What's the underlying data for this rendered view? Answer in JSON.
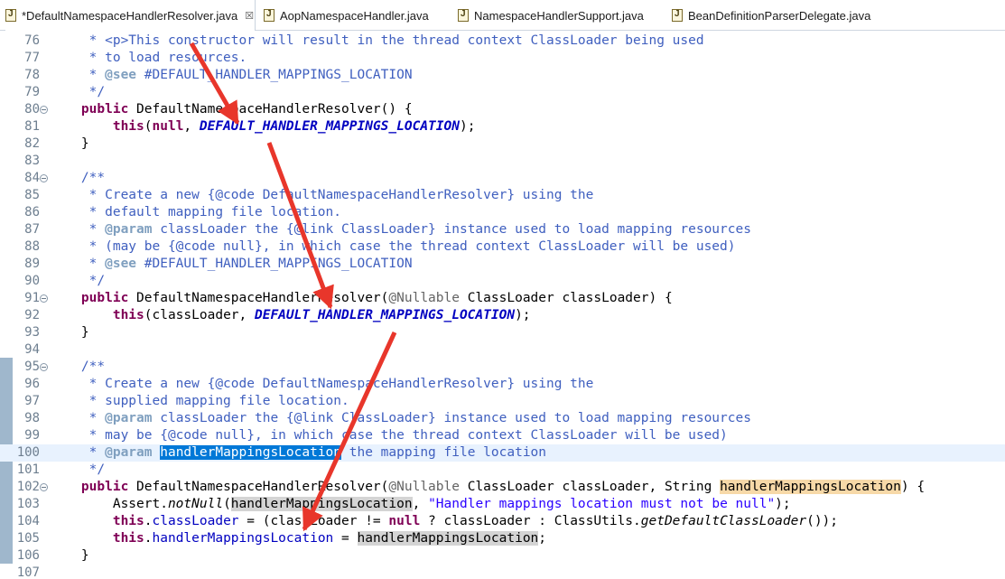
{
  "tabs": [
    {
      "label": "*DefaultNamespaceHandlerResolver.java",
      "close": "☒",
      "icon": "java-file-icon"
    },
    {
      "label": "AopNamespaceHandler.java",
      "icon": "java-file-icon"
    },
    {
      "label": "NamespaceHandlerSupport.java",
      "icon": "java-file-icon"
    },
    {
      "label": "BeanDefinitionParserDelegate.java",
      "icon": "java-file-icon"
    }
  ],
  "colors": {
    "keyword": "#7f0055",
    "comment": "#3f5fbf",
    "javadoc_tag": "#7f9fbf",
    "static_field": "#0000c0",
    "string": "#2a00ff",
    "selection": "#0078d7",
    "annotation_arrow": "#e8362b"
  },
  "editor": {
    "lines": [
      {
        "n": "76",
        "fold": false,
        "t": [
          [
            "cm",
            "     * <p>This constructor will result in the thread context ClassLoader being used"
          ]
        ]
      },
      {
        "n": "77",
        "fold": false,
        "t": [
          [
            "cm",
            "     * to load resources."
          ]
        ]
      },
      {
        "n": "78",
        "fold": false,
        "t": [
          [
            "cm",
            "     * "
          ],
          [
            "tag",
            "@see"
          ],
          [
            "cm",
            " #DEFAULT_HANDLER_MAPPINGS_LOCATION"
          ]
        ]
      },
      {
        "n": "79",
        "fold": false,
        "t": [
          [
            "cm",
            "     */"
          ]
        ]
      },
      {
        "n": "80",
        "fold": true,
        "t": [
          [
            "",
            "    "
          ],
          [
            "k",
            "public"
          ],
          [
            "",
            " DefaultNamespaceHandlerResolver() {"
          ]
        ]
      },
      {
        "n": "81",
        "fold": false,
        "t": [
          [
            "",
            "        "
          ],
          [
            "k",
            "this"
          ],
          [
            "",
            "("
          ],
          [
            "k",
            "null"
          ],
          [
            "",
            ", "
          ],
          [
            "st",
            "DEFAULT_HANDLER_MAPPINGS_LOCATION"
          ],
          [
            "",
            ");"
          ]
        ]
      },
      {
        "n": "82",
        "fold": false,
        "t": [
          [
            "",
            "    }"
          ]
        ]
      },
      {
        "n": "83",
        "fold": false,
        "t": []
      },
      {
        "n": "84",
        "fold": true,
        "t": [
          [
            "cm",
            "    /**"
          ]
        ]
      },
      {
        "n": "85",
        "fold": false,
        "t": [
          [
            "cm",
            "     * Create a new {@code DefaultNamespaceHandlerResolver} using the"
          ]
        ]
      },
      {
        "n": "86",
        "fold": false,
        "t": [
          [
            "cm",
            "     * default mapping file location."
          ]
        ]
      },
      {
        "n": "87",
        "fold": false,
        "t": [
          [
            "cm",
            "     * "
          ],
          [
            "tag",
            "@param"
          ],
          [
            "cm",
            " classLoader the {@link ClassLoader} instance used to load mapping resources"
          ]
        ]
      },
      {
        "n": "88",
        "fold": false,
        "t": [
          [
            "cm",
            "     * (may be {@code null}, in which case the thread context ClassLoader will be used)"
          ]
        ]
      },
      {
        "n": "89",
        "fold": false,
        "t": [
          [
            "cm",
            "     * "
          ],
          [
            "tag",
            "@see"
          ],
          [
            "cm",
            " #DEFAULT_HANDLER_MAPPINGS_LOCATION"
          ]
        ]
      },
      {
        "n": "90",
        "fold": false,
        "t": [
          [
            "cm",
            "     */"
          ]
        ]
      },
      {
        "n": "91",
        "fold": true,
        "t": [
          [
            "",
            "    "
          ],
          [
            "k",
            "public"
          ],
          [
            "",
            " DefaultNamespaceHandlerResolver("
          ],
          [
            "an",
            "@Nullable"
          ],
          [
            "",
            " ClassLoader classLoader) {"
          ]
        ]
      },
      {
        "n": "92",
        "fold": false,
        "t": [
          [
            "",
            "        "
          ],
          [
            "k",
            "this"
          ],
          [
            "",
            "(classLoader, "
          ],
          [
            "st",
            "DEFAULT_HANDLER_MAPPINGS_LOCATION"
          ],
          [
            "",
            ");"
          ]
        ]
      },
      {
        "n": "93",
        "fold": false,
        "t": [
          [
            "",
            "    }"
          ]
        ]
      },
      {
        "n": "94",
        "fold": false,
        "t": []
      },
      {
        "n": "95",
        "fold": true,
        "t": [
          [
            "cm",
            "    /**"
          ]
        ]
      },
      {
        "n": "96",
        "fold": false,
        "t": [
          [
            "cm",
            "     * Create a new {@code DefaultNamespaceHandlerResolver} using the"
          ]
        ]
      },
      {
        "n": "97",
        "fold": false,
        "t": [
          [
            "cm",
            "     * supplied mapping file location."
          ]
        ]
      },
      {
        "n": "98",
        "fold": false,
        "t": [
          [
            "cm",
            "     * "
          ],
          [
            "tag",
            "@param"
          ],
          [
            "cm",
            " classLoader the {@link ClassLoader} instance used to load mapping resources"
          ]
        ]
      },
      {
        "n": "99",
        "fold": false,
        "t": [
          [
            "cm",
            "     * may be {@code null}, in which case the thread context ClassLoader will be used)"
          ]
        ]
      },
      {
        "n": "100",
        "fold": false,
        "current": true,
        "t": [
          [
            "cm",
            "     * "
          ],
          [
            "tag",
            "@param"
          ],
          [
            "cm",
            " "
          ],
          [
            "sel",
            "handlerMappingsLocation"
          ],
          [
            "cm",
            " the mapping file location"
          ]
        ]
      },
      {
        "n": "101",
        "fold": false,
        "t": [
          [
            "cm",
            "     */"
          ]
        ]
      },
      {
        "n": "102",
        "fold": true,
        "t": [
          [
            "",
            "    "
          ],
          [
            "k",
            "public"
          ],
          [
            "",
            " DefaultNamespaceHandlerResolver("
          ],
          [
            "an",
            "@Nullable"
          ],
          [
            "",
            " ClassLoader classLoader, String "
          ],
          [
            "occw",
            "handlerMappingsLocation"
          ],
          [
            "",
            ") {"
          ]
        ]
      },
      {
        "n": "103",
        "fold": false,
        "t": [
          [
            "",
            "        Assert."
          ],
          [
            "mi",
            "notNull"
          ],
          [
            "",
            "("
          ],
          [
            "occ",
            "handlerMappingsLocation"
          ],
          [
            "",
            ", "
          ],
          [
            "str",
            "\"Handler mappings location must not be null\""
          ],
          [
            "",
            ");"
          ]
        ]
      },
      {
        "n": "104",
        "fold": false,
        "t": [
          [
            "",
            "        "
          ],
          [
            "k",
            "this"
          ],
          [
            "",
            "."
          ],
          [
            "fld",
            "classLoader"
          ],
          [
            "",
            " = (classLoader != "
          ],
          [
            "k",
            "null"
          ],
          [
            "",
            " ? classLoader : ClassUtils."
          ],
          [
            "mi",
            "getDefaultClassLoader"
          ],
          [
            "",
            "());"
          ]
        ]
      },
      {
        "n": "105",
        "fold": false,
        "t": [
          [
            "",
            "        "
          ],
          [
            "k",
            "this"
          ],
          [
            "",
            "."
          ],
          [
            "fld",
            "handlerMappingsLocation"
          ],
          [
            "",
            " = "
          ],
          [
            "occ",
            "handlerMappingsLocation"
          ],
          [
            "",
            ";"
          ]
        ]
      },
      {
        "n": "106",
        "fold": false,
        "t": [
          [
            "",
            "    }"
          ]
        ]
      },
      {
        "n": "107",
        "fold": false,
        "t": []
      }
    ]
  }
}
